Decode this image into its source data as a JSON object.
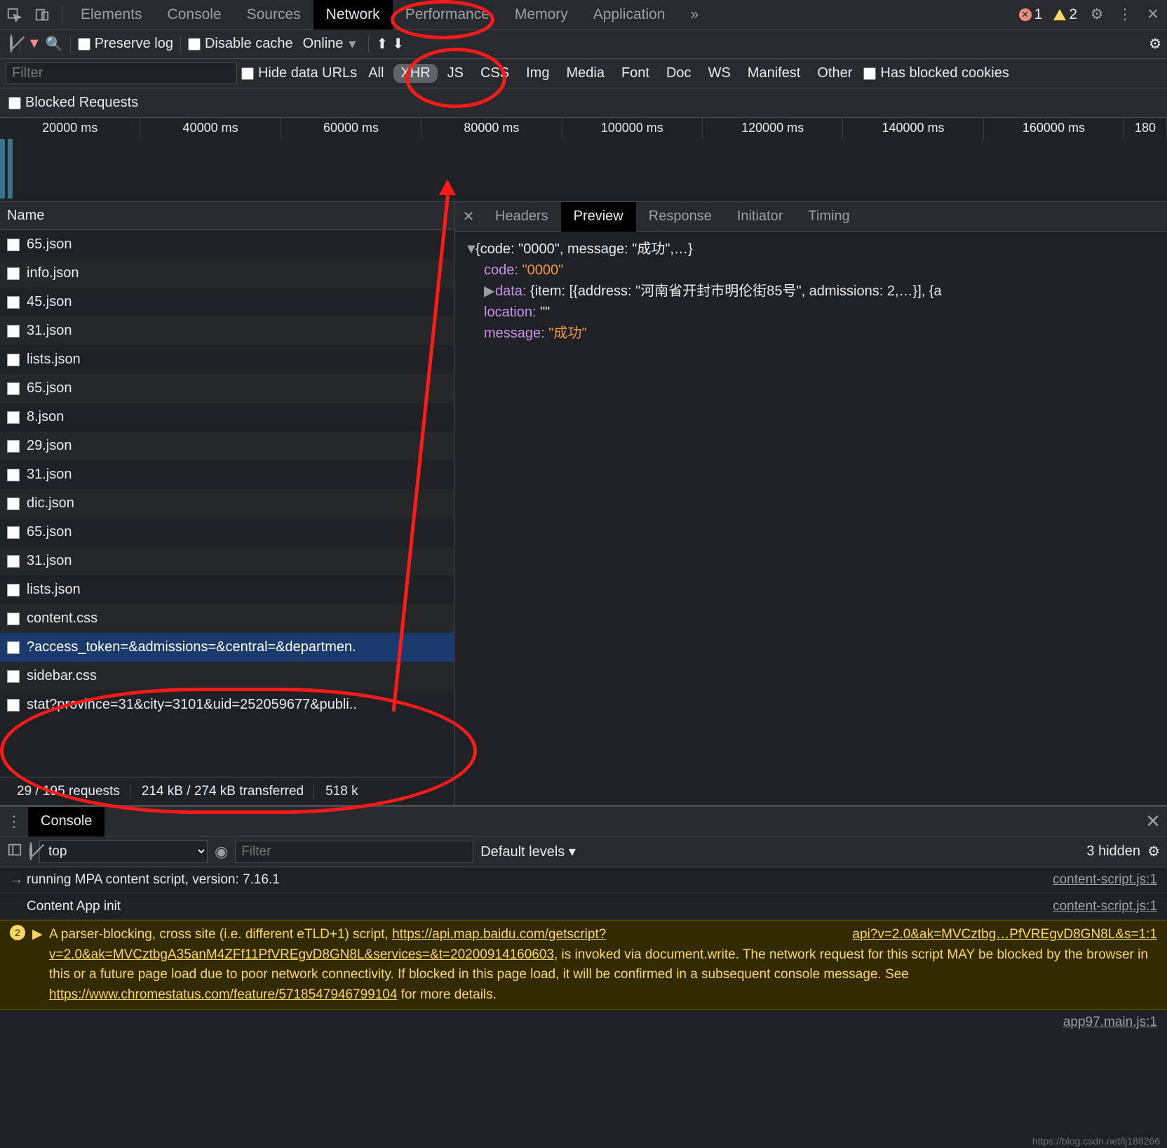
{
  "main_tabs": {
    "items": [
      "Elements",
      "Console",
      "Sources",
      "Network",
      "Performance",
      "Memory",
      "Application"
    ],
    "active": "Network",
    "overflow": "»",
    "errors": "1",
    "warnings": "2"
  },
  "net_toolbar": {
    "preserve_log": "Preserve log",
    "disable_cache": "Disable cache",
    "throttle": "Online"
  },
  "filter_row": {
    "filter_placeholder": "Filter",
    "hide_data_urls": "Hide data URLs",
    "chips": [
      "All",
      "XHR",
      "JS",
      "CSS",
      "Img",
      "Media",
      "Font",
      "Doc",
      "WS",
      "Manifest",
      "Other"
    ],
    "active_chip": "XHR",
    "has_blocked_cookies": "Has blocked cookies"
  },
  "blocked_row": {
    "blocked_requests": "Blocked Requests"
  },
  "timeline": {
    "ticks": [
      "20000 ms",
      "40000 ms",
      "60000 ms",
      "80000 ms",
      "100000 ms",
      "120000 ms",
      "140000 ms",
      "160000 ms",
      "180"
    ]
  },
  "requests": {
    "header": "Name",
    "rows": [
      {
        "name": "65.json"
      },
      {
        "name": "info.json"
      },
      {
        "name": "45.json"
      },
      {
        "name": "31.json"
      },
      {
        "name": "lists.json"
      },
      {
        "name": "65.json"
      },
      {
        "name": "8.json"
      },
      {
        "name": "29.json"
      },
      {
        "name": "31.json"
      },
      {
        "name": "dic.json"
      },
      {
        "name": "65.json"
      },
      {
        "name": "31.json"
      },
      {
        "name": "lists.json"
      },
      {
        "name": "content.css"
      },
      {
        "name": "?access_token=&admissions=&central=&departmen.",
        "selected": true
      },
      {
        "name": "sidebar.css"
      },
      {
        "name": "stat?province=31&city=3101&uid=252059677&publi.."
      }
    ],
    "status": {
      "requests": "29 / 195 requests",
      "transferred": "214 kB / 274 kB transferred",
      "resources": "518 k"
    }
  },
  "detail": {
    "tabs": [
      "Headers",
      "Preview",
      "Response",
      "Initiator",
      "Timing"
    ],
    "active": "Preview",
    "preview": {
      "root_summary": "{code: \"0000\", message: \"成功\",…}",
      "code_key": "code:",
      "code_val": "\"0000\"",
      "data_key": "data:",
      "data_val": "{item: [{address: \"河南省开封市明伦街85号\", admissions: 2,…}], {a",
      "location_key": "location:",
      "location_val": "\"\"",
      "message_key": "message:",
      "message_val": "\"成功\""
    }
  },
  "console": {
    "drawer_tab": "Console",
    "context": "top",
    "filter_placeholder": "Filter",
    "levels": "Default levels ▾",
    "hidden": "3 hidden",
    "lines": [
      {
        "msg": "running MPA content script, version: 7.16.1",
        "src": "content-script.js:1"
      },
      {
        "msg": "Content App init",
        "src": "content-script.js:1"
      }
    ],
    "warn": {
      "count": "2",
      "src": "api?v=2.0&ak=MVCztbg…PfVREgvD8GN8L&s=1:1",
      "text_pre": "A parser-blocking, cross site (i.e. different eTLD+1) script, ",
      "url1": "https://api.map.baidu.com/getscript?v=2.0&ak=MVCztbgA35anM4ZFf11PfVREgvD8GN8L&services=&t=20200914160603",
      "text_mid": ", is invoked via document.write. The network request for this script MAY be blocked by the browser in this or a future page load due to poor network connectivity. If blocked in this page load, it will be confirmed in a subsequent console message. See ",
      "url2": "https://www.chromestatus.com/feature/5718547946799104",
      "text_post": " for more details."
    },
    "last_src": "app97.main.js:1"
  },
  "watermark": "https://blog.csdn.net/lj188266"
}
